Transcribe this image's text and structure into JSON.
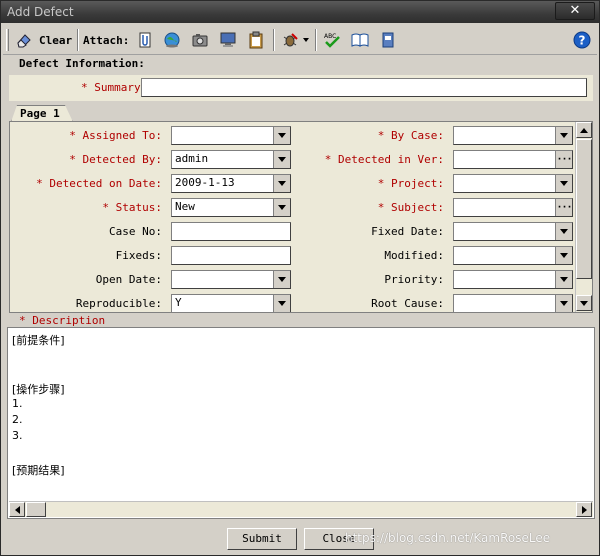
{
  "window": {
    "title": "Add Defect",
    "close_symbol": "✕"
  },
  "toolbar": {
    "clear_label": "Clear",
    "attach_label": "Attach:",
    "icons": [
      "eraser-icon",
      "attach-file-icon",
      "attach-url-icon",
      "attach-snapshot-icon",
      "attach-sysinfo-icon",
      "attach-clipboard-icon",
      "defect-tools-icon",
      "spell-check-icon",
      "thesaurus-icon",
      "spelling-options-icon",
      "help-icon"
    ]
  },
  "defect_info_label": "Defect Information:",
  "summary": {
    "label": "* Summary",
    "value": ""
  },
  "tabs": [
    {
      "label": "Page 1"
    }
  ],
  "fields_left": [
    {
      "label": "* Assigned To:",
      "value": "",
      "required": true,
      "type": "combo"
    },
    {
      "label": "* Detected By:",
      "value": "admin",
      "required": true,
      "type": "combo"
    },
    {
      "label": "* Detected on Date:",
      "value": "2009-1-13",
      "required": true,
      "type": "combo"
    },
    {
      "label": "* Status:",
      "value": "New",
      "required": true,
      "type": "combo"
    },
    {
      "label": "Case No:",
      "value": "",
      "required": false,
      "type": "text"
    },
    {
      "label": "Fixeds:",
      "value": "",
      "required": false,
      "type": "text"
    },
    {
      "label": "Open Date:",
      "value": "",
      "required": false,
      "type": "combo"
    },
    {
      "label": "Reproducible:",
      "value": "Y",
      "required": false,
      "type": "combo"
    }
  ],
  "fields_right": [
    {
      "label": "* By Case:",
      "value": "",
      "required": true,
      "type": "combo"
    },
    {
      "label": "* Detected in Ver:",
      "value": "",
      "required": true,
      "type": "picker"
    },
    {
      "label": "* Project:",
      "value": "",
      "required": true,
      "type": "combo"
    },
    {
      "label": "* Subject:",
      "value": "",
      "required": true,
      "type": "picker"
    },
    {
      "label": "Fixed Date:",
      "value": "",
      "required": false,
      "type": "combo"
    },
    {
      "label": "Modified:",
      "value": "",
      "required": false,
      "type": "combo"
    },
    {
      "label": "Priority:",
      "value": "",
      "required": false,
      "type": "combo"
    },
    {
      "label": "Root Cause:",
      "value": "",
      "required": false,
      "type": "combo"
    }
  ],
  "description": {
    "label": "* Description",
    "lines": [
      "[前提条件]",
      "",
      "",
      "[操作步骤]",
      "1.",
      "2.",
      "3.",
      "",
      "[预期结果]"
    ]
  },
  "buttons": {
    "submit": "Submit",
    "close": "Close"
  },
  "watermark": "https://blog.csdn.net/KamRoseLee",
  "colors": {
    "required": "#b00000",
    "chrome": "#d4d0c8",
    "panel": "#ece9d8",
    "help_blue": "#1c5fc6"
  }
}
